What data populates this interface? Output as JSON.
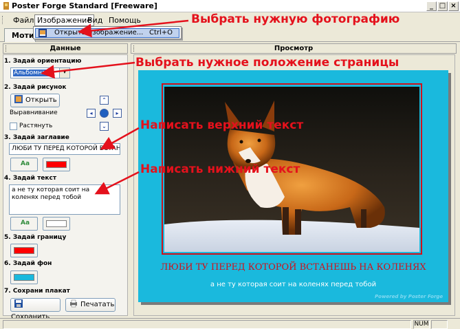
{
  "window": {
    "title": "Poster Forge Standard [Freeware]",
    "btn_min": "_",
    "btn_max": "□",
    "btn_close": "×"
  },
  "menu": {
    "items": [
      "Файл",
      "Изображение",
      "Вид",
      "Помощь"
    ]
  },
  "dropdown": {
    "item_label": "Открыть изображение...",
    "shortcut": "Ctrl+O"
  },
  "tabs": {
    "active": "Мотив"
  },
  "panels": {
    "data_title": "Данные",
    "preview_title": "Просмотр"
  },
  "sections": {
    "orientation": {
      "label": "1. Задай ориентацию",
      "value": "Альбомная",
      "arrow": "▾"
    },
    "picture": {
      "label": "2. Задай рисунок",
      "open_button": "Открыть",
      "align_label": "Выравнивание",
      "stretch_label": "Растянуть"
    },
    "title": {
      "label": "3. Задай заглавие",
      "value": "ЛЮБИ ТУ ПЕРЕД КОТОРОЙ ВСТАНЕШЬ"
    },
    "text": {
      "label": "4. Задай текст",
      "value": "а не ту которая соит на коленях перед тобой"
    },
    "border": {
      "label": "5. Задай границу"
    },
    "background": {
      "label": "6. Задай фон"
    },
    "save": {
      "label": "7. Сохрани плакат",
      "save_button": "Сохранить",
      "print_button": "Печатать"
    }
  },
  "colors": {
    "title_color": "#ff0000",
    "text_color": "#ffffff",
    "border_color": "#ff0000",
    "background_color": "#1ab9dd"
  },
  "poster": {
    "headline": "ЛЮБИ ТУ ПЕРЕД КОТОРОЙ ВСТАНЕШЬ НА КОЛЕНЯХ",
    "subline": "а не ту которая соит на коленях перед тобой",
    "credit": "Powered by Poster Forge"
  },
  "annotations": {
    "a1": "Выбрать нужную фотографию",
    "a2": "Выбрать нужное положение страницы",
    "a3": "Написать верхний текст",
    "a4": "Написать нижний текст"
  },
  "statusbar": {
    "num": "NUM"
  }
}
